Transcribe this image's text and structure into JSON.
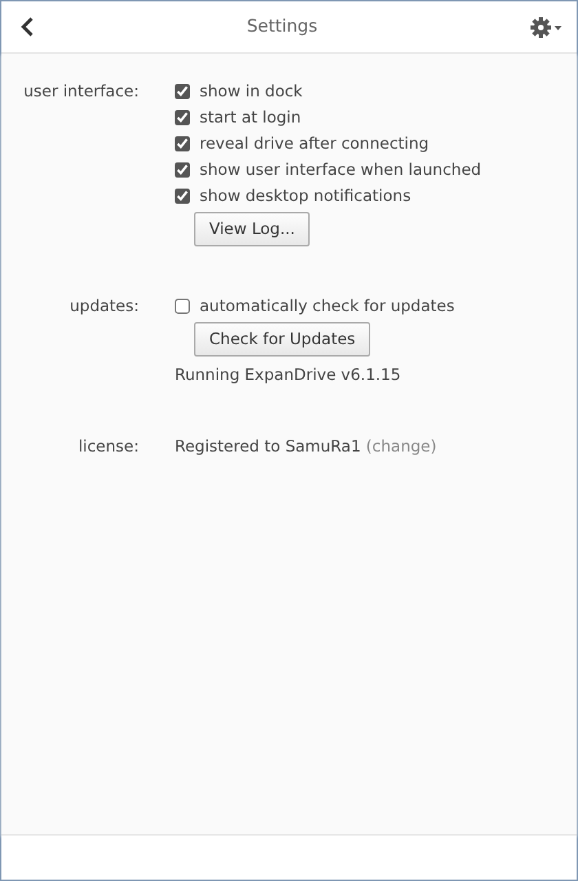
{
  "header": {
    "title": "Settings"
  },
  "sections": [
    {
      "label": "user interface:",
      "options": [
        {
          "text": "show in dock",
          "checked": true
        },
        {
          "text": "start at login",
          "checked": true
        },
        {
          "text": "reveal drive after connecting",
          "checked": true
        },
        {
          "text": "show user interface when launched",
          "checked": true
        },
        {
          "text": "show desktop notifications",
          "checked": true
        }
      ],
      "button": "View Log..."
    },
    {
      "label": "updates:",
      "options": [
        {
          "text": "automatically check for updates",
          "checked": false
        }
      ],
      "button": "Check for Updates",
      "note": "Running ExpanDrive v6.1.15"
    },
    {
      "label": "license:",
      "text": "Registered to SamuRa1",
      "link_open": "(",
      "link": "change",
      "link_close": ")"
    }
  ]
}
